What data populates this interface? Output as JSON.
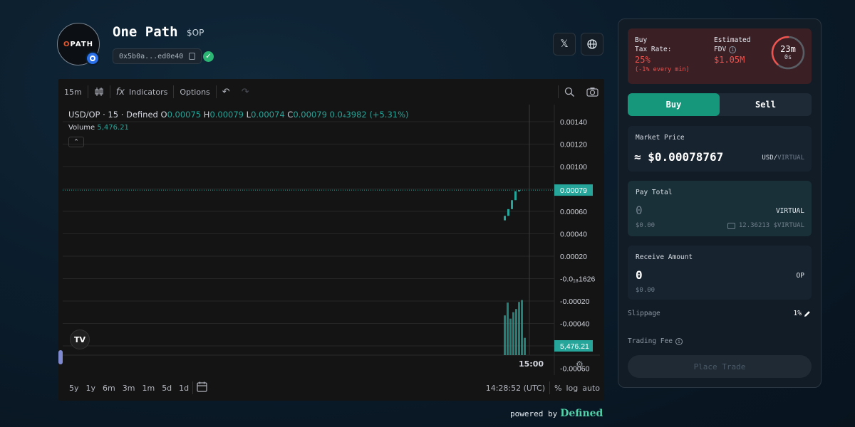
{
  "token": {
    "logo_text": "PATH",
    "logo_prefix": "O",
    "name": "One Path",
    "symbol": "$OP",
    "address": "0x5b0a...ed0e40"
  },
  "social": {
    "x_label": "𝕏",
    "web_label": "🌐"
  },
  "chart": {
    "toolbar": {
      "interval": "15m",
      "indicators": "Indicators",
      "options": "Options",
      "fx": "fx"
    },
    "legend": {
      "pair": "USD/OP · 15 · Defined",
      "o_label": "O",
      "o": "0.00075",
      "h_label": "H",
      "h": "0.00079",
      "l_label": "L",
      "l": "0.00074",
      "c_label": "C",
      "c": "0.00079",
      "change": "0.0₄3982 (+5.31%)"
    },
    "volume_label": "Volume",
    "volume_value": "5,476.21",
    "tv_logo": "TV",
    "time_label": "15:00",
    "ranges": [
      "5y",
      "1y",
      "6m",
      "3m",
      "1m",
      "5d",
      "1d"
    ],
    "clock": "14:28:52 (UTC)",
    "percent": "%",
    "log": "log",
    "auto": "auto",
    "colors": {
      "up": "#26a69a",
      "grid": "#262626"
    }
  },
  "chart_data": {
    "type": "candlestick",
    "y_ticks": [
      "0.00140",
      "0.00120",
      "0.00100",
      "0.00079",
      "0.00060",
      "0.00040",
      "0.00020",
      "-0.0₁₈1626",
      "-0.00020",
      "-0.00040",
      "5,476.21",
      "-0.00060"
    ],
    "last_price": "0.00079",
    "last_volume": "5,476.21",
    "x_label": "15:00",
    "candles": [
      {
        "o": 0.00052,
        "c": 0.00056
      },
      {
        "o": 0.00056,
        "c": 0.00062
      },
      {
        "o": 0.00062,
        "c": 0.0007
      },
      {
        "o": 0.0007,
        "c": 0.00078
      },
      {
        "o": 0.00078,
        "c": 0.00079
      }
    ]
  },
  "powered": {
    "prefix": "powered by",
    "brand": "Defined"
  },
  "trade": {
    "buy_tax_label_1": "Buy",
    "buy_tax_label_2": "Tax Rate:",
    "buy_tax_value": "25%",
    "buy_tax_note": "(-1% every min)",
    "fdv_label_1": "Estimated",
    "fdv_label_2": "FDV",
    "fdv_value": "$1.05M",
    "timer_main": "23m",
    "timer_sub": "0s",
    "buy_tab": "Buy",
    "sell_tab": "Sell",
    "market_price_label": "Market Price",
    "market_price_prefix": "≈",
    "market_price_value": "$0.00078767",
    "market_price_unit_main": "USD/",
    "market_price_unit_sub": "VIRTUAL",
    "pay_total_label": "Pay Total",
    "pay_amount": "0",
    "pay_unit": "VIRTUAL",
    "pay_usd": "$0.00",
    "balance": "12.36213 $VIRTUAL",
    "receive_label": "Receive Amount",
    "receive_amount": "0",
    "receive_unit": "OP",
    "receive_usd": "$0.00",
    "slippage_label": "Slippage",
    "slippage_value": "1%",
    "fee_label": "Trading Fee",
    "place_trade": "Place Trade"
  }
}
